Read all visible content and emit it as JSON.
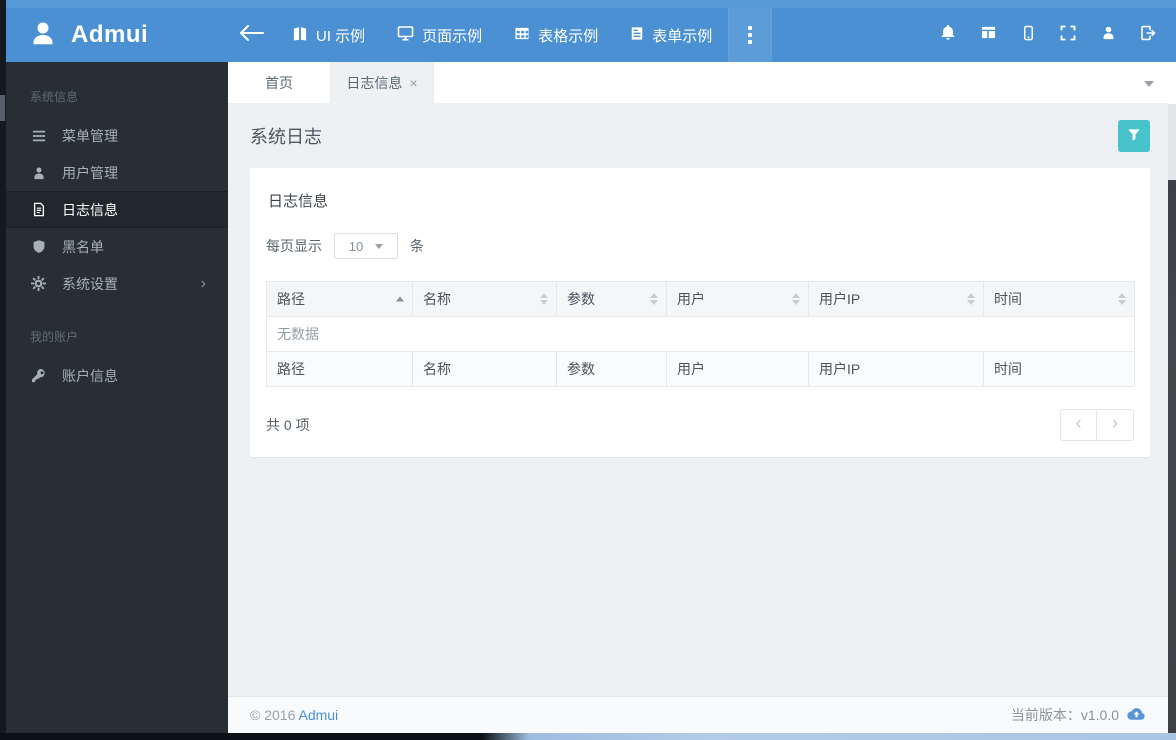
{
  "colors": {
    "navbar_blue": "#4a90d2",
    "accent_teal": "#48c2cb",
    "sidebar_bg": "#272f34",
    "link_blue": "#4a90d2"
  },
  "navbar": {
    "brand": "Admui",
    "back_icon": "arrow-left-icon",
    "items": [
      {
        "label": "UI 示例",
        "icon": "book-icon"
      },
      {
        "label": "页面示例",
        "icon": "monitor-icon"
      },
      {
        "label": "表格示例",
        "icon": "table-icon"
      },
      {
        "label": "表单示例",
        "icon": "form-icon"
      }
    ],
    "more_icon": "vertical-dots-icon",
    "right_icons": [
      "bell-icon",
      "layout-icon",
      "mobile-icon",
      "fullscreen-icon",
      "user-icon",
      "logout-icon"
    ]
  },
  "sidebar": {
    "sections": [
      {
        "label": "系统信息",
        "items": [
          {
            "label": "菜单管理",
            "icon": "menu-bars-icon",
            "active": false
          },
          {
            "label": "用户管理",
            "icon": "user-icon",
            "active": false
          },
          {
            "label": "日志信息",
            "icon": "file-text-icon",
            "active": true
          },
          {
            "label": "黑名单",
            "icon": "shield-icon",
            "active": false
          },
          {
            "label": "系统设置",
            "icon": "gear-icon",
            "active": false,
            "has_submenu": true
          }
        ]
      },
      {
        "label": "我的账户",
        "items": [
          {
            "label": "账户信息",
            "icon": "key-icon",
            "active": false
          }
        ]
      }
    ]
  },
  "tabbar": {
    "tabs": [
      {
        "label": "首页",
        "active": false,
        "closable": false
      },
      {
        "label": "日志信息",
        "active": true,
        "closable": true
      }
    ]
  },
  "page": {
    "title": "系统日志",
    "filter_icon": "funnel-icon"
  },
  "panel": {
    "title": "日志信息",
    "page_size": {
      "label_prefix": "每页显示",
      "selected": "10",
      "label_suffix": "条"
    },
    "table": {
      "columns": [
        "路径",
        "名称",
        "参数",
        "用户",
        "用户IP",
        "时间"
      ],
      "sorted_column": "路径",
      "sort_direction": "asc",
      "empty_text": "无数据",
      "rows": []
    },
    "total_text": "共 0 项"
  },
  "footer": {
    "copyright": "© 2016",
    "brand_link": "Admui",
    "version_text": "当前版本：v1.0.0",
    "upload_icon": "cloud-upload-icon"
  }
}
